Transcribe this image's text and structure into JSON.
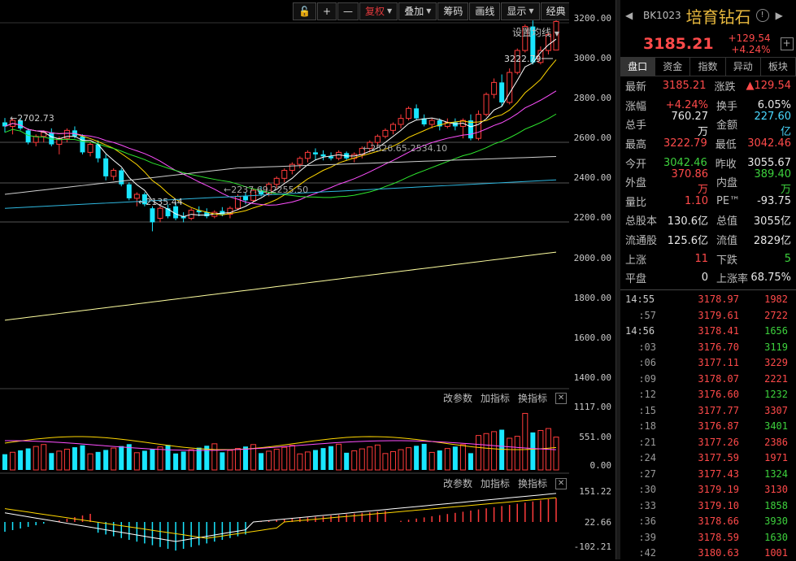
{
  "toolbar": {
    "items": [
      "复权",
      "叠加",
      "筹码",
      "画线",
      "显示",
      "经典"
    ],
    "active": "复权"
  },
  "ma_settings": "设置均线",
  "chart_data": {
    "type": "candlestick",
    "yaxis_ticks": [
      "3200.00",
      "3000.00",
      "2800.00",
      "2600.00",
      "2400.00",
      "2200.00",
      "2000.00",
      "1800.00",
      "1600.00",
      "1400.00"
    ],
    "ylim": [
      1380,
      3260
    ],
    "annotations": [
      "3222.79",
      "2702.73",
      "2135.44",
      "2237.69-2255.50",
      "2526.65-2534.10"
    ],
    "candles": [
      [
        2680,
        2702,
        2630,
        2660
      ],
      [
        2660,
        2700,
        2620,
        2690
      ],
      [
        2690,
        2700,
        2640,
        2650
      ],
      [
        2640,
        2650,
        2570,
        2580
      ],
      [
        2580,
        2620,
        2560,
        2610
      ],
      [
        2610,
        2640,
        2580,
        2630
      ],
      [
        2630,
        2650,
        2560,
        2570
      ],
      [
        2570,
        2610,
        2520,
        2600
      ],
      [
        2600,
        2650,
        2580,
        2640
      ],
      [
        2640,
        2660,
        2600,
        2610
      ],
      [
        2610,
        2620,
        2520,
        2530
      ],
      [
        2530,
        2580,
        2510,
        2570
      ],
      [
        2570,
        2590,
        2480,
        2500
      ],
      [
        2500,
        2520,
        2390,
        2410
      ],
      [
        2410,
        2450,
        2390,
        2440
      ],
      [
        2440,
        2450,
        2360,
        2370
      ],
      [
        2370,
        2380,
        2290,
        2300
      ],
      [
        2300,
        2330,
        2260,
        2320
      ],
      [
        2320,
        2330,
        2260,
        2270
      ],
      [
        2250,
        2260,
        2135,
        2180
      ],
      [
        2200,
        2260,
        2180,
        2250
      ],
      [
        2250,
        2270,
        2200,
        2210
      ],
      [
        2260,
        2280,
        2190,
        2200
      ],
      [
        2210,
        2230,
        2180,
        2200
      ],
      [
        2200,
        2250,
        2190,
        2240
      ],
      [
        2240,
        2260,
        2210,
        2230
      ],
      [
        2230,
        2250,
        2200,
        2210
      ],
      [
        2210,
        2240,
        2200,
        2230
      ],
      [
        2237,
        2256,
        2210,
        2220
      ],
      [
        2220,
        2260,
        2200,
        2250
      ],
      [
        2250,
        2320,
        2240,
        2310
      ],
      [
        2310,
        2330,
        2270,
        2290
      ],
      [
        2290,
        2350,
        2280,
        2340
      ],
      [
        2340,
        2360,
        2310,
        2320
      ],
      [
        2320,
        2380,
        2310,
        2370
      ],
      [
        2370,
        2410,
        2350,
        2400
      ],
      [
        2400,
        2450,
        2380,
        2440
      ],
      [
        2440,
        2480,
        2420,
        2470
      ],
      [
        2470,
        2510,
        2450,
        2500
      ],
      [
        2500,
        2540,
        2480,
        2530
      ],
      [
        2530,
        2550,
        2490,
        2520
      ],
      [
        2520,
        2540,
        2490,
        2510
      ],
      [
        2510,
        2530,
        2490,
        2500
      ],
      [
        2500,
        2540,
        2490,
        2530
      ],
      [
        2526,
        2534,
        2490,
        2500
      ],
      [
        2500,
        2530,
        2480,
        2520
      ],
      [
        2520,
        2560,
        2500,
        2550
      ],
      [
        2550,
        2590,
        2530,
        2580
      ],
      [
        2580,
        2620,
        2560,
        2610
      ],
      [
        2610,
        2650,
        2600,
        2640
      ],
      [
        2640,
        2680,
        2620,
        2670
      ],
      [
        2670,
        2720,
        2650,
        2700
      ],
      [
        2700,
        2760,
        2690,
        2750
      ],
      [
        2750,
        2770,
        2690,
        2700
      ],
      [
        2700,
        2720,
        2660,
        2670
      ],
      [
        2670,
        2700,
        2650,
        2690
      ],
      [
        2690,
        2700,
        2640,
        2660
      ],
      [
        2660,
        2700,
        2650,
        2680
      ],
      [
        2680,
        2700,
        2640,
        2660
      ],
      [
        2660,
        2700,
        2600,
        2690
      ],
      [
        2690,
        2720,
        2590,
        2600
      ],
      [
        2600,
        2740,
        2590,
        2720
      ],
      [
        2720,
        2830,
        2710,
        2820
      ],
      [
        2820,
        2900,
        2800,
        2880
      ],
      [
        2880,
        2920,
        2760,
        2780
      ],
      [
        2780,
        2950,
        2770,
        2930
      ],
      [
        2930,
        3050,
        2920,
        3040
      ],
      [
        3040,
        3170,
        3030,
        3160
      ],
      [
        3160,
        3190,
        2970,
        2980
      ],
      [
        2980,
        3060,
        2970,
        3040
      ],
      [
        3040,
        3130,
        3020,
        3120
      ],
      [
        3042,
        3223,
        3042,
        3185
      ]
    ],
    "sub1": {
      "controls": [
        "改参数",
        "加指标",
        "换指标"
      ],
      "ticks": [
        "1117.00",
        "551.00",
        "0.00"
      ]
    },
    "sub2": {
      "controls": [
        "改参数",
        "加指标",
        "换指标"
      ],
      "ticks": [
        "151.22",
        "22.66",
        "-102.21"
      ]
    }
  },
  "panel": {
    "code": "BK1023",
    "name": "培育钻石",
    "price": "3185.21",
    "change": "+129.54",
    "change_pct": "+4.24%",
    "tabs": [
      "盘口",
      "资金",
      "指数",
      "异动",
      "板块"
    ],
    "quote_rows": [
      {
        "l1": "最新",
        "v1": "3185.21",
        "c1": "red",
        "l2": "涨跌",
        "v2": "▲129.54",
        "c2": "red"
      },
      {
        "l1": "涨幅",
        "v1": "+4.24%",
        "c1": "red",
        "l2": "换手",
        "v2": "6.05%",
        "c2": "white"
      },
      {
        "l1": "总手",
        "v1": "760.27万",
        "c1": "white",
        "l2": "金额",
        "v2": "227.60亿",
        "c2": "cyan"
      },
      {
        "l1": "最高",
        "v1": "3222.79",
        "c1": "red",
        "l2": "最低",
        "v2": "3042.46",
        "c2": "red"
      },
      {
        "l1": "今开",
        "v1": "3042.46",
        "c1": "green",
        "l2": "昨收",
        "v2": "3055.67",
        "c2": "white"
      },
      {
        "l1": "外盘",
        "v1": "370.86万",
        "c1": "red",
        "l2": "内盘",
        "v2": "389.40万",
        "c2": "green"
      },
      {
        "l1": "量比",
        "v1": "1.10",
        "c1": "red",
        "l2": "PE™",
        "v2": "-93.75",
        "c2": "white"
      },
      {
        "l1": "总股本",
        "v1": "130.6亿",
        "c1": "white",
        "l2": "总值",
        "v2": "3055亿",
        "c2": "white"
      },
      {
        "l1": "流通股",
        "v1": "125.6亿",
        "c1": "white",
        "l2": "流值",
        "v2": "2829亿",
        "c2": "white"
      },
      {
        "l1": "上涨",
        "v1": "11",
        "c1": "red",
        "l2": "下跌",
        "v2": "5",
        "c2": "green"
      },
      {
        "l1": "平盘",
        "v1": "0",
        "c1": "white",
        "l2": "上涨率",
        "v2": "68.75%",
        "c2": "white"
      }
    ],
    "ticks": [
      {
        "t": "14:55",
        "main": true,
        "p": "3178.97",
        "v": "1982",
        "c": "red"
      },
      {
        "t": ":57",
        "main": false,
        "p": "3179.61",
        "v": "2722",
        "c": "red"
      },
      {
        "t": "14:56",
        "main": true,
        "p": "3178.41",
        "v": "1656",
        "c": "green"
      },
      {
        "t": ":03",
        "main": false,
        "p": "3176.70",
        "v": "3119",
        "c": "green"
      },
      {
        "t": ":06",
        "main": false,
        "p": "3177.11",
        "v": "3229",
        "c": "red"
      },
      {
        "t": ":09",
        "main": false,
        "p": "3178.07",
        "v": "2221",
        "c": "red"
      },
      {
        "t": ":12",
        "main": false,
        "p": "3176.60",
        "v": "1232",
        "c": "green"
      },
      {
        "t": ":15",
        "main": false,
        "p": "3177.77",
        "v": "3307",
        "c": "red"
      },
      {
        "t": ":18",
        "main": false,
        "p": "3176.87",
        "v": "3401",
        "c": "green"
      },
      {
        "t": ":21",
        "main": false,
        "p": "3177.26",
        "v": "2386",
        "c": "red"
      },
      {
        "t": ":24",
        "main": false,
        "p": "3177.59",
        "v": "1971",
        "c": "red"
      },
      {
        "t": ":27",
        "main": false,
        "p": "3177.43",
        "v": "1324",
        "c": "green"
      },
      {
        "t": ":30",
        "main": false,
        "p": "3179.19",
        "v": "3130",
        "c": "red"
      },
      {
        "t": ":33",
        "main": false,
        "p": "3179.10",
        "v": "1858",
        "c": "green"
      },
      {
        "t": ":36",
        "main": false,
        "p": "3178.66",
        "v": "3930",
        "c": "green"
      },
      {
        "t": ":39",
        "main": false,
        "p": "3178.59",
        "v": "1630",
        "c": "green"
      },
      {
        "t": ":42",
        "main": false,
        "p": "3180.63",
        "v": "1001",
        "c": "red"
      }
    ]
  }
}
